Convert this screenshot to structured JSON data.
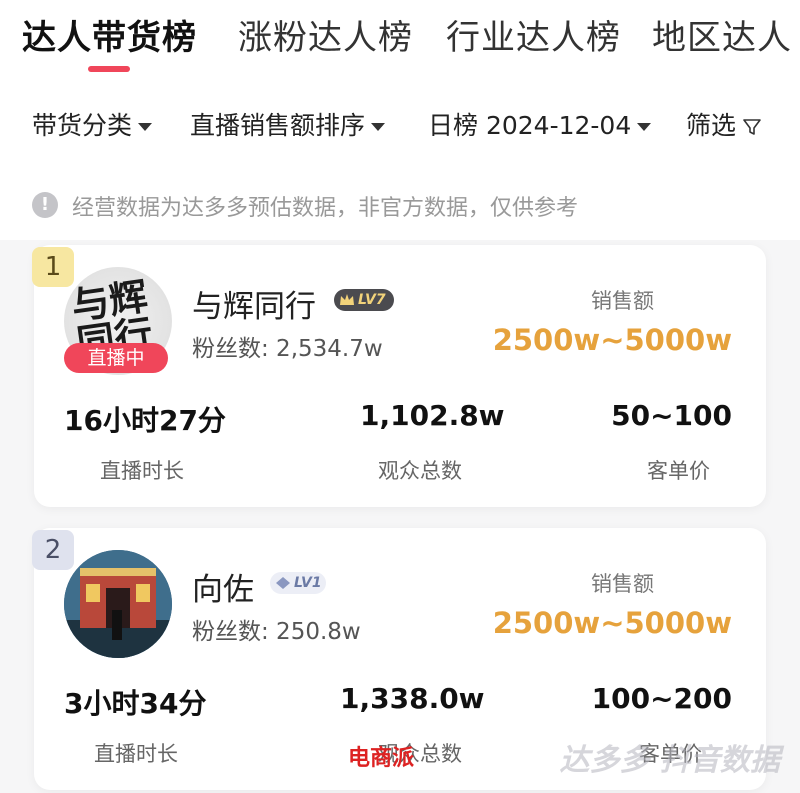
{
  "tabs": [
    {
      "label": "达人带货榜",
      "active": true
    },
    {
      "label": "涨粉达人榜",
      "active": false
    },
    {
      "label": "行业达人榜",
      "active": false
    },
    {
      "label": "地区达人",
      "active": false
    }
  ],
  "filters": {
    "category": "带货分类",
    "sort": "直播销售额排序",
    "date_label": "日榜 2024-12-04",
    "filter": "筛选"
  },
  "notice": {
    "icon": "!",
    "text": "经营数据为达多多预估数据，非官方数据，仅供参考"
  },
  "ranking": [
    {
      "rank": "1",
      "avatar_text": "与辉同行",
      "live_badge": "直播中",
      "name": "与辉同行",
      "level": "LV7",
      "fans": "粉丝数: 2,534.7w",
      "sales_label": "销售额",
      "sales_value": "2500w~5000w",
      "stats": [
        {
          "value": "16小时27分",
          "label": "直播时长"
        },
        {
          "value": "1,102.8w",
          "label": "观众总数"
        },
        {
          "value": "50~100",
          "label": "客单价"
        }
      ]
    },
    {
      "rank": "2",
      "name": "向佐",
      "level": "LV1",
      "fans": "粉丝数: 250.8w",
      "sales_label": "销售额",
      "sales_value": "2500w~5000w",
      "stats": [
        {
          "value": "3小时34分",
          "label": "直播时长"
        },
        {
          "value": "1,338.0w",
          "label": "观众总数"
        },
        {
          "value": "100~200",
          "label": "客单价"
        }
      ]
    }
  ],
  "watermark": "达多多 抖音数据",
  "brand_mark": "电商派",
  "colors": {
    "accent": "#f0465a",
    "sales": "#e6a23c",
    "gold_rank": "#f7e7a1",
    "silver_rank": "#dfe2ee"
  }
}
